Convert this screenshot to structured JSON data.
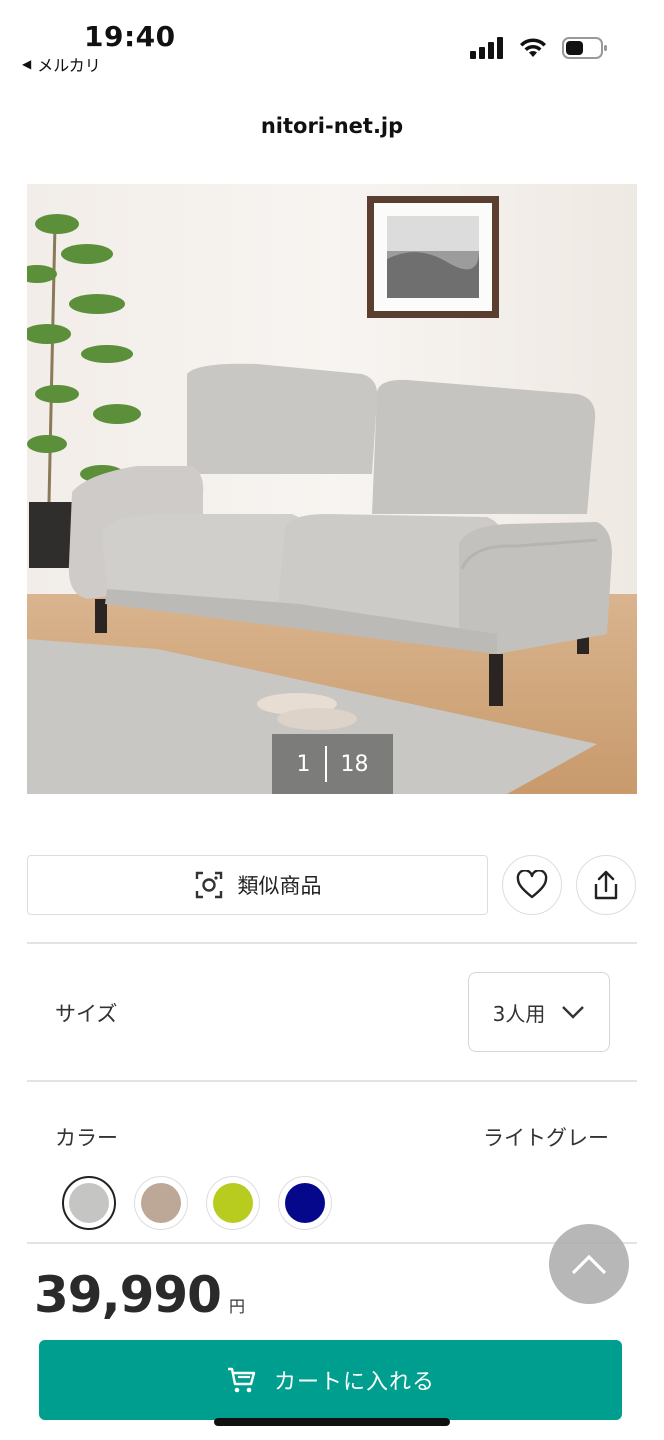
{
  "status_bar": {
    "time": "19:40",
    "back_app": "メルカリ",
    "icons": [
      "signal-icon",
      "wifi-icon",
      "battery-icon"
    ]
  },
  "browser": {
    "url": "nitori-net.jp"
  },
  "gallery": {
    "current": "1",
    "total": "18"
  },
  "actions": {
    "similar_label": "類似商品",
    "similar_icon": "image-search-icon",
    "favorite_icon": "heart-icon",
    "share_icon": "share-icon"
  },
  "size": {
    "label": "サイズ",
    "selected": "3人用"
  },
  "color": {
    "label": "カラー",
    "selected_name": "ライトグレー",
    "swatches": [
      {
        "hex": "#c5c5c3",
        "selected": true
      },
      {
        "hex": "#bda796",
        "selected": false
      },
      {
        "hex": "#b8cb1f",
        "selected": false
      },
      {
        "hex": "#06088c",
        "selected": false
      }
    ]
  },
  "price": {
    "value": "39,990",
    "unit": "円"
  },
  "cart": {
    "label": "カートに入れる",
    "icon": "cart-icon"
  },
  "colors": {
    "accent": "#009e8f",
    "text": "#222222",
    "border": "#dddddd"
  }
}
